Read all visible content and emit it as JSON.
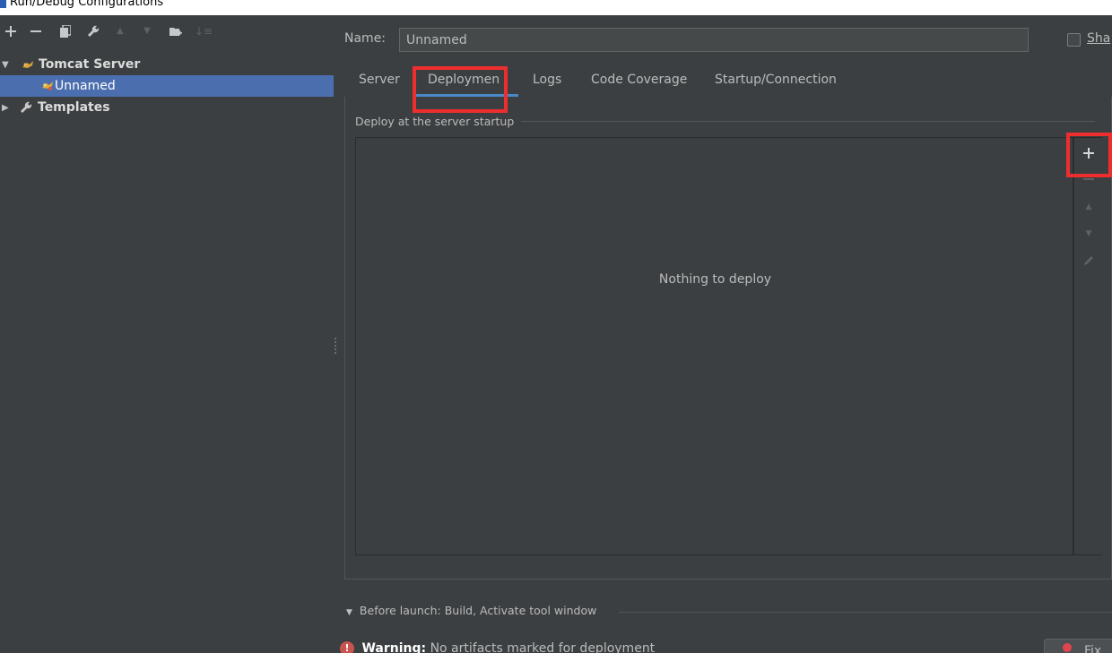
{
  "window": {
    "title": "Run/Debug Configurations"
  },
  "colors": {
    "background": "#3c3f41",
    "selection": "#4b6eaf",
    "highlight": "#ee2e2e",
    "tab_underline": "#4a88c7",
    "error": "#c75450"
  },
  "toolbar": {
    "add_icon": "plus-icon",
    "remove_icon": "minus-icon",
    "copy_icon": "copy-icon",
    "edit_defaults_icon": "wrench-icon",
    "move_up_icon": "arrow-up-icon",
    "move_down_icon": "arrow-down-icon",
    "folder_icon": "folder-icon",
    "sort_icon": "sort-icon"
  },
  "tree": {
    "items": [
      {
        "label": "Tomcat Server",
        "expanded": true
      },
      {
        "label": "Unnamed",
        "selected": true
      },
      {
        "label": "Templates",
        "expanded": false
      }
    ]
  },
  "config": {
    "name_label": "Name:",
    "name_value": "Unnamed",
    "share_label": "Sha"
  },
  "tabs": [
    {
      "label": "Server"
    },
    {
      "label": "Deploymen",
      "active": true
    },
    {
      "label": "Logs"
    },
    {
      "label": "Code Coverage"
    },
    {
      "label": "Startup/Connection"
    }
  ],
  "deployment": {
    "section_title": "Deploy at the server startup",
    "empty_text": "Nothing to deploy"
  },
  "before_launch": {
    "label": "Before launch: Build, Activate tool window"
  },
  "warning": {
    "prefix": "Warning:",
    "message": "No artifacts marked for deployment",
    "fix_label": "Fix"
  }
}
